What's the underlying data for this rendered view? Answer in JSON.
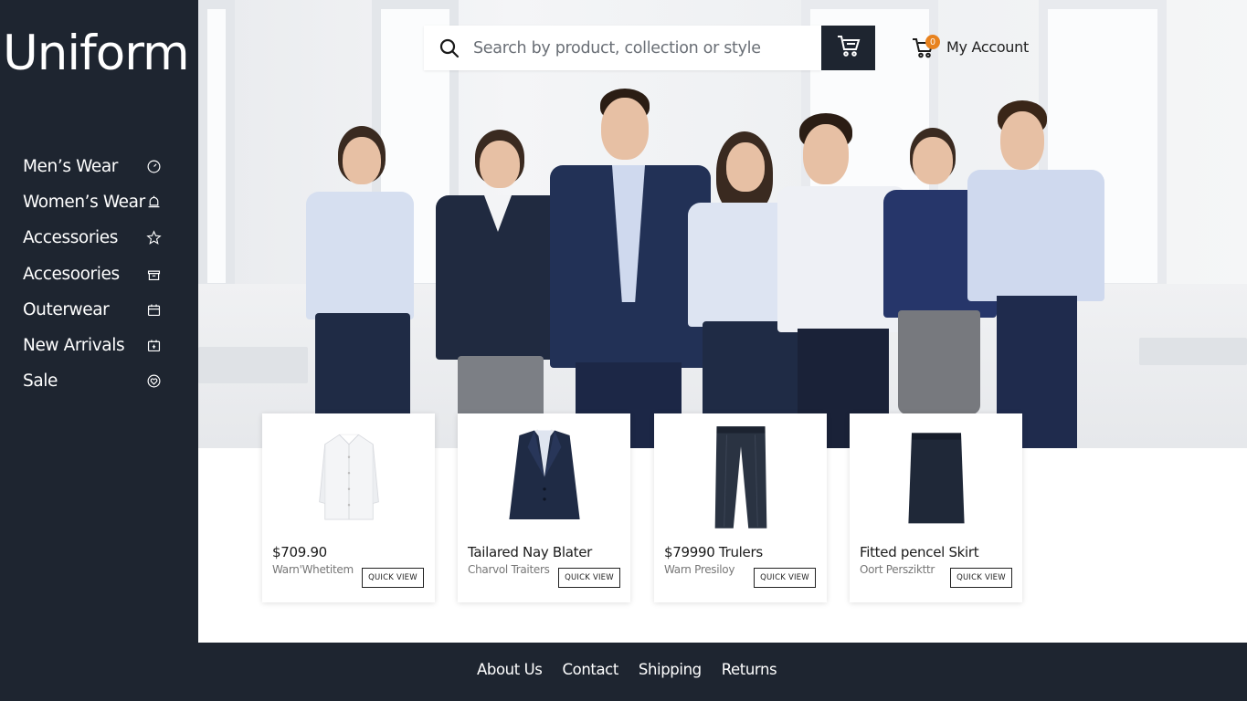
{
  "brand": {
    "name": "Uniform"
  },
  "sidebar": {
    "items": [
      {
        "label": "Men’s Wear",
        "icon": "clock-icon"
      },
      {
        "label": "Women’s Wear",
        "icon": "bell-icon"
      },
      {
        "label": "Accessories",
        "icon": "star-icon"
      },
      {
        "label": "Accesoories",
        "icon": "box-icon"
      },
      {
        "label": "Outerwear",
        "icon": "calendar-icon"
      },
      {
        "label": "New Arrivals",
        "icon": "calendar-plus-icon"
      },
      {
        "label": "Sale",
        "icon": "heart-icon"
      }
    ]
  },
  "search": {
    "placeholder": "Search by product, collection or style",
    "value": ""
  },
  "header": {
    "cart_icon": "cart-icon",
    "account_label": "My Account",
    "cart_count": "0"
  },
  "products": [
    {
      "title": "$709.90",
      "subtitle": "Warn'Whetitem",
      "quick_view": "QUICK VIEW",
      "image": "white-shirt"
    },
    {
      "title": "Tailared Nay Blater",
      "subtitle": "Charvol Traiters",
      "quick_view": "QUICK VIEW",
      "image": "navy-blazer"
    },
    {
      "title": "$79990 Trulers",
      "subtitle": "Warn Presiloy",
      "quick_view": "QUICK VIEW",
      "image": "navy-trousers"
    },
    {
      "title": "Fitted pencel Skirt",
      "subtitle": "Oort Perszikttr",
      "quick_view": "QUICK VIEW",
      "image": "pencil-skirt"
    }
  ],
  "footer": {
    "links": [
      "About Us",
      "Contact",
      "Shipping",
      "Returns"
    ]
  },
  "colors": {
    "sidebar": "#1e2530",
    "accent": "#e8821e",
    "navy": "#1f2b45"
  }
}
